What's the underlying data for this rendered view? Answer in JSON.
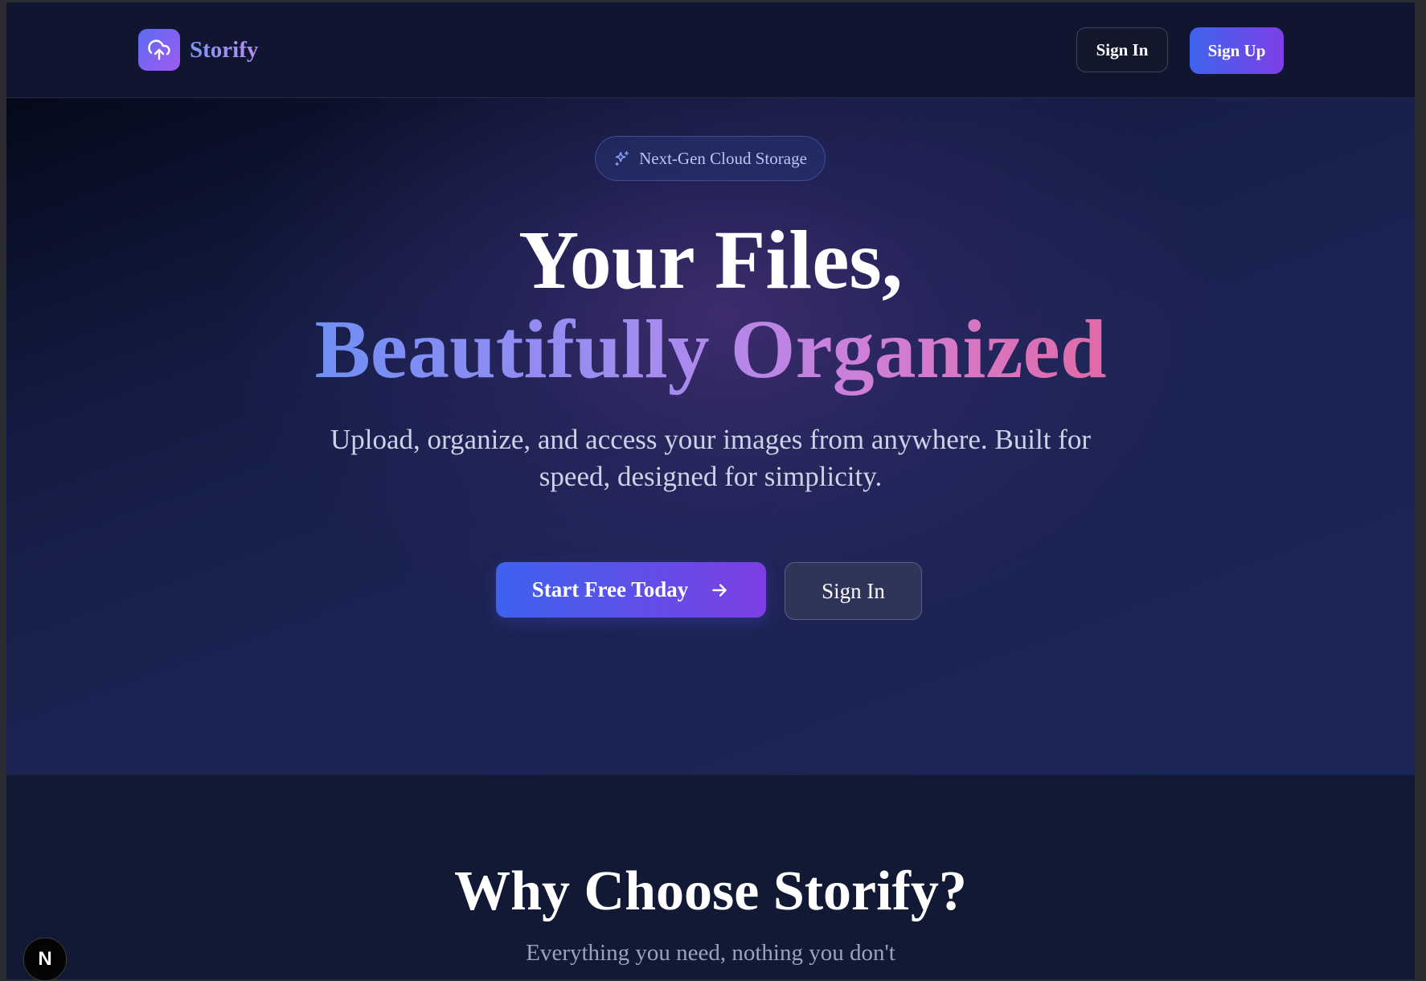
{
  "header": {
    "brand": "Storify",
    "signin_label": "Sign In",
    "signup_label": "Sign Up"
  },
  "hero": {
    "badge": "Next-Gen Cloud Storage",
    "title_line1": "Your Files,",
    "title_line2": "Beautifully Organized",
    "subtitle": "Upload, organize, and access your images from anywhere. Built for speed, designed for simplicity.",
    "cta_primary": "Start Free Today",
    "cta_secondary": "Sign In"
  },
  "why": {
    "title": "Why Choose Storify?",
    "subtitle": "Everything you need, nothing you don't"
  },
  "dev_badge": "N",
  "icons": {
    "logo": "cloud-upload-icon",
    "badge": "sparkles-icon",
    "cta": "arrow-right-icon"
  },
  "colors": {
    "accent_start": "#3f63ee",
    "accent_end": "#7d3fe6",
    "background": "#121934"
  }
}
